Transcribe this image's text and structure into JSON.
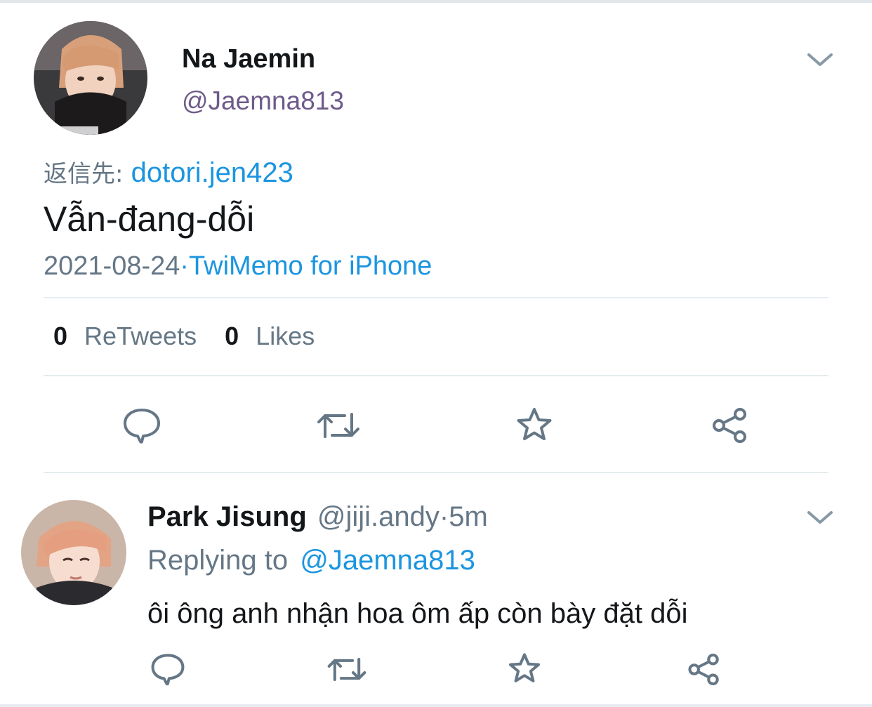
{
  "main_tweet": {
    "display_name": "Na Jaemin",
    "handle": "@Jaemna813",
    "reply_to_label": "返信先:",
    "reply_to_handle": "dotori.jen423",
    "text": "Vẫn-đang-dỗi",
    "date": "2021-08-24",
    "separator": "·",
    "source": "TwiMemo for iPhone",
    "retweets_count": "0",
    "retweets_label": "ReTweets",
    "likes_count": "0",
    "likes_label": "Likes"
  },
  "reply": {
    "display_name": "Park Jisung",
    "handle": "@jiji.andy",
    "separator": "·",
    "time": "5m",
    "replying_label": "Replying to",
    "replying_handle": "@Jaemna813",
    "text": "ôi ông anh nhận hoa ôm ấp còn bày đặt dỗi"
  },
  "icons": [
    "chevron-down-icon",
    "reply-icon",
    "retweet-icon",
    "star-icon",
    "share-icon"
  ],
  "colors": {
    "link": "#1b95e0",
    "muted": "#657786",
    "handle_purple": "#6e5a8a",
    "icon": "#657786",
    "divider": "#e6ecf0"
  }
}
